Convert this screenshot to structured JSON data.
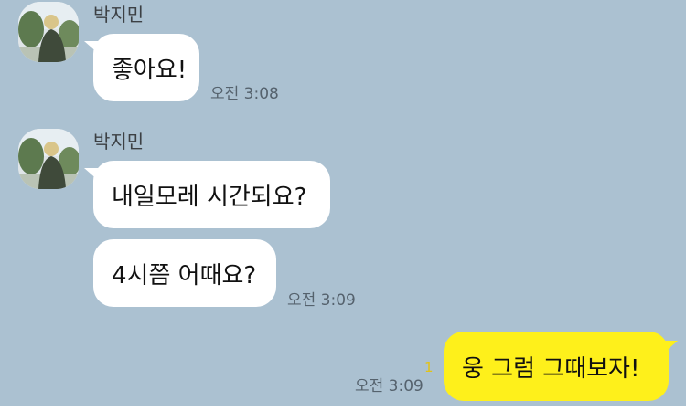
{
  "colors": {
    "background": "#abc1d1",
    "incoming_bubble": "#ffffff",
    "outgoing_bubble": "#fef01b",
    "unread_count": "#e2c317"
  },
  "messages": [
    {
      "sender": "박지민",
      "avatar_icon": "profile-photo-icon",
      "texts": [
        "좋아요!"
      ],
      "time": "오전 3:08"
    },
    {
      "sender": "박지민",
      "avatar_icon": "profile-photo-icon",
      "texts": [
        "내일모레 시간되요?",
        "4시쯤 어때요?"
      ],
      "time": "오전 3:09"
    }
  ],
  "my_message": {
    "text": "웅 그럼 그때보자!",
    "time": "오전 3:09",
    "unread": "1"
  }
}
